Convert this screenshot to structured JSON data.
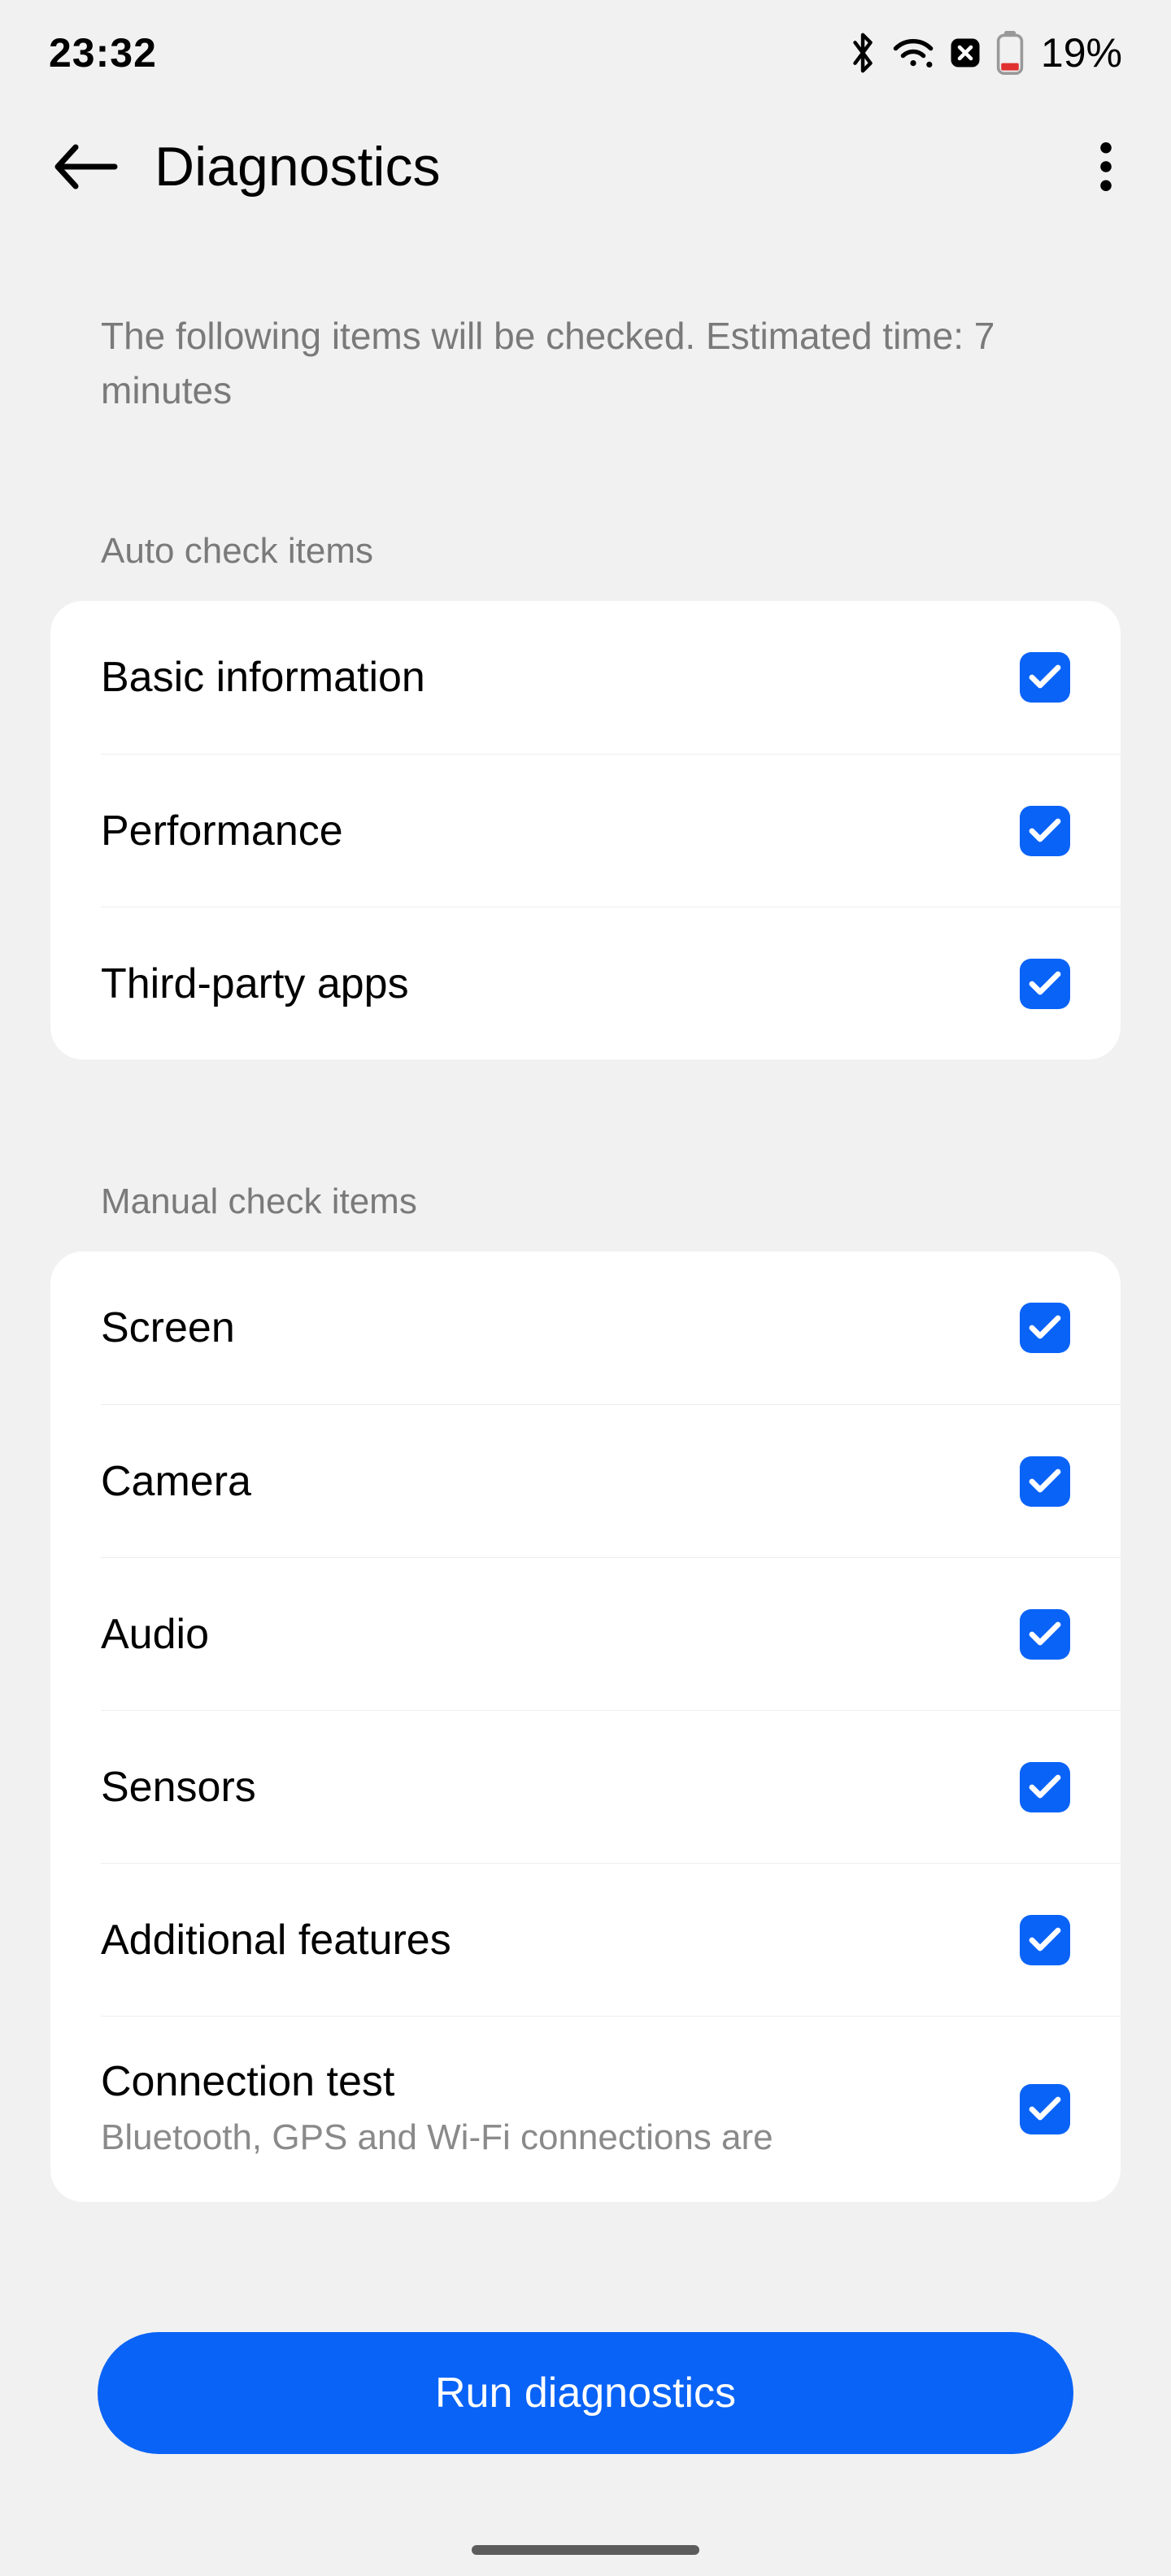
{
  "status": {
    "time": "23:32",
    "battery_pct": "19%"
  },
  "header": {
    "title": "Diagnostics"
  },
  "subtitle": "The following items will be checked. Estimated time: 7 minutes",
  "sections": {
    "auto_header": "Auto check items",
    "manual_header": "Manual check items"
  },
  "auto_items": {
    "0": {
      "label": "Basic information"
    },
    "1": {
      "label": "Performance"
    },
    "2": {
      "label": "Third-party apps"
    }
  },
  "manual_items": {
    "0": {
      "label": "Screen"
    },
    "1": {
      "label": "Camera"
    },
    "2": {
      "label": "Audio"
    },
    "3": {
      "label": "Sensors"
    },
    "4": {
      "label": "Additional features"
    },
    "5": {
      "label": "Connection test",
      "sub": "Bluetooth, GPS and Wi-Fi connections are"
    }
  },
  "button": {
    "run": "Run diagnostics"
  },
  "colors": {
    "accent": "#0a63f7"
  }
}
